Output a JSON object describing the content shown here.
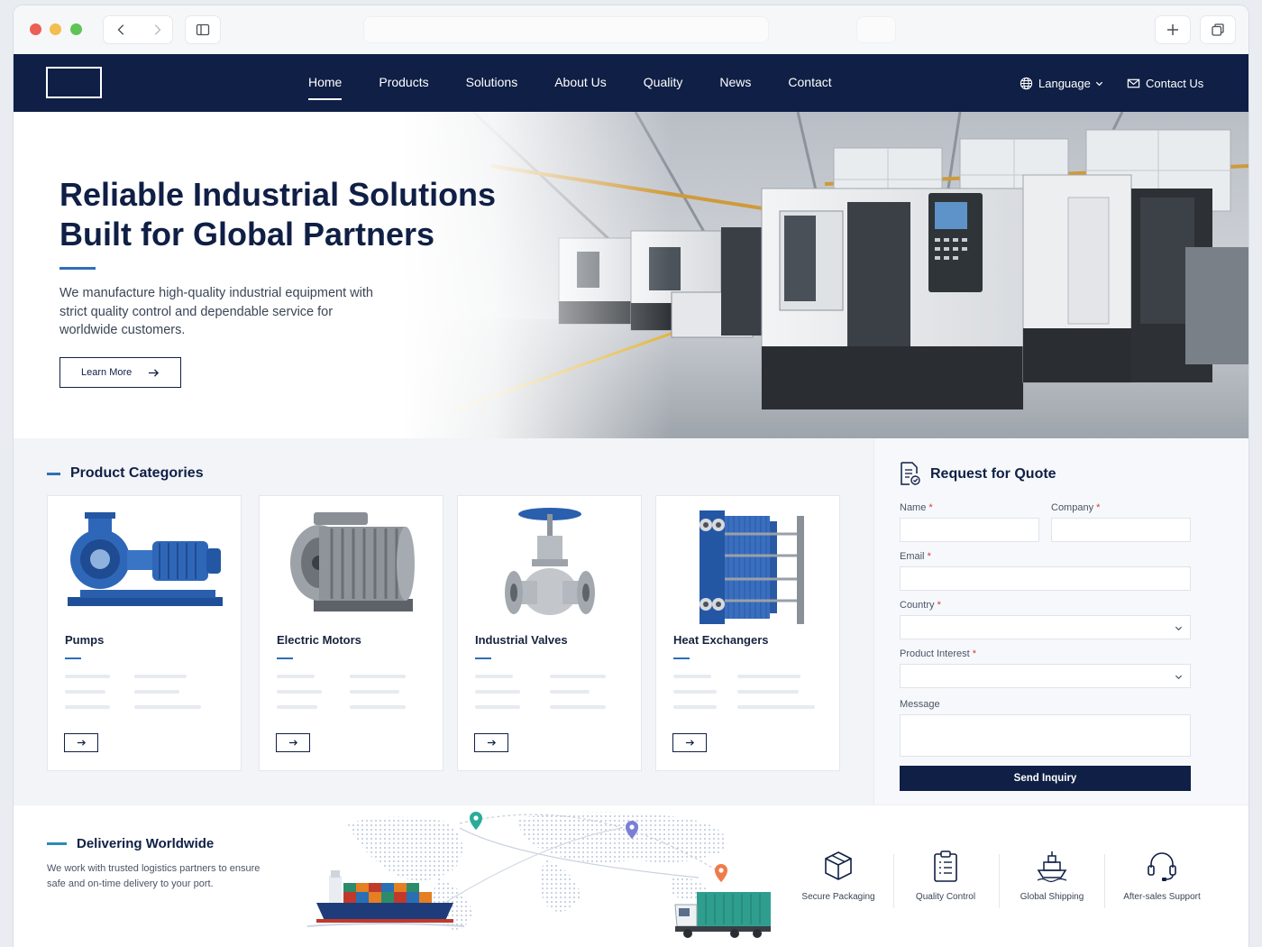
{
  "header": {
    "nav": [
      "Home",
      "Products",
      "Solutions",
      "About Us",
      "Quality",
      "News",
      "Contact"
    ],
    "active": "Home",
    "language_label": "Language",
    "contact_label": "Contact Us"
  },
  "hero": {
    "title_line1": "Reliable Industrial Solutions",
    "title_line2": "Built for Global Partners",
    "text": "We manufacture high-quality industrial equipment with strict quality control and dependable service for worldwide customers.",
    "button": "Learn More"
  },
  "categories": {
    "heading": "Product Categories",
    "items": [
      {
        "name": "Pumps",
        "image": "blue-centrifugal-pump"
      },
      {
        "name": "Electric Motors",
        "image": "electric-motor"
      },
      {
        "name": "Industrial Valves",
        "image": "gate-valve"
      },
      {
        "name": "Heat Exchangers",
        "image": "plate-heat-exchanger"
      }
    ]
  },
  "quote": {
    "heading": "Request for Quote",
    "fields": {
      "name": "Name",
      "company": "Company",
      "email": "Email",
      "country": "Country",
      "interest": "Product Interest",
      "message": "Message"
    },
    "required_mark": "*",
    "submit": "Send Inquiry"
  },
  "shipping": {
    "heading": "Delivering Worldwide",
    "text": "We work with trusted logistics partners to ensure safe and on-time delivery to your port.",
    "features": [
      "Secure Packaging",
      "Quality Control",
      "Global Shipping",
      "After-sales Support"
    ]
  },
  "colors": {
    "navy": "#0f1f45",
    "accent_blue": "#2f6fb7",
    "pin_teal": "#2bab9a",
    "pin_purple": "#7a7fd6",
    "pin_orange": "#ef7b4a"
  }
}
